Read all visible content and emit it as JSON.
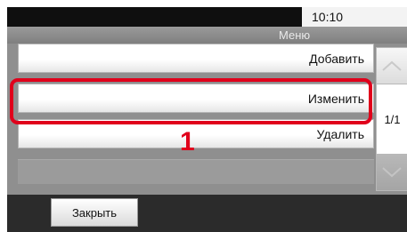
{
  "status": {
    "time": "10:10"
  },
  "header": {
    "title": "Меню"
  },
  "menu": {
    "items": [
      {
        "label": "Добавить"
      },
      {
        "label": "Изменить"
      },
      {
        "label": "Удалить"
      }
    ]
  },
  "pager": {
    "page": "1/1"
  },
  "callout": {
    "number": "1"
  },
  "footer": {
    "close_label": "Закрыть"
  },
  "colors": {
    "highlight": "#e0001b",
    "status_bar": "#0f0f0f",
    "panel": "#8f8f8f"
  },
  "icons": {
    "scroll_up": "chevron-up-icon",
    "scroll_down": "chevron-down-icon"
  }
}
